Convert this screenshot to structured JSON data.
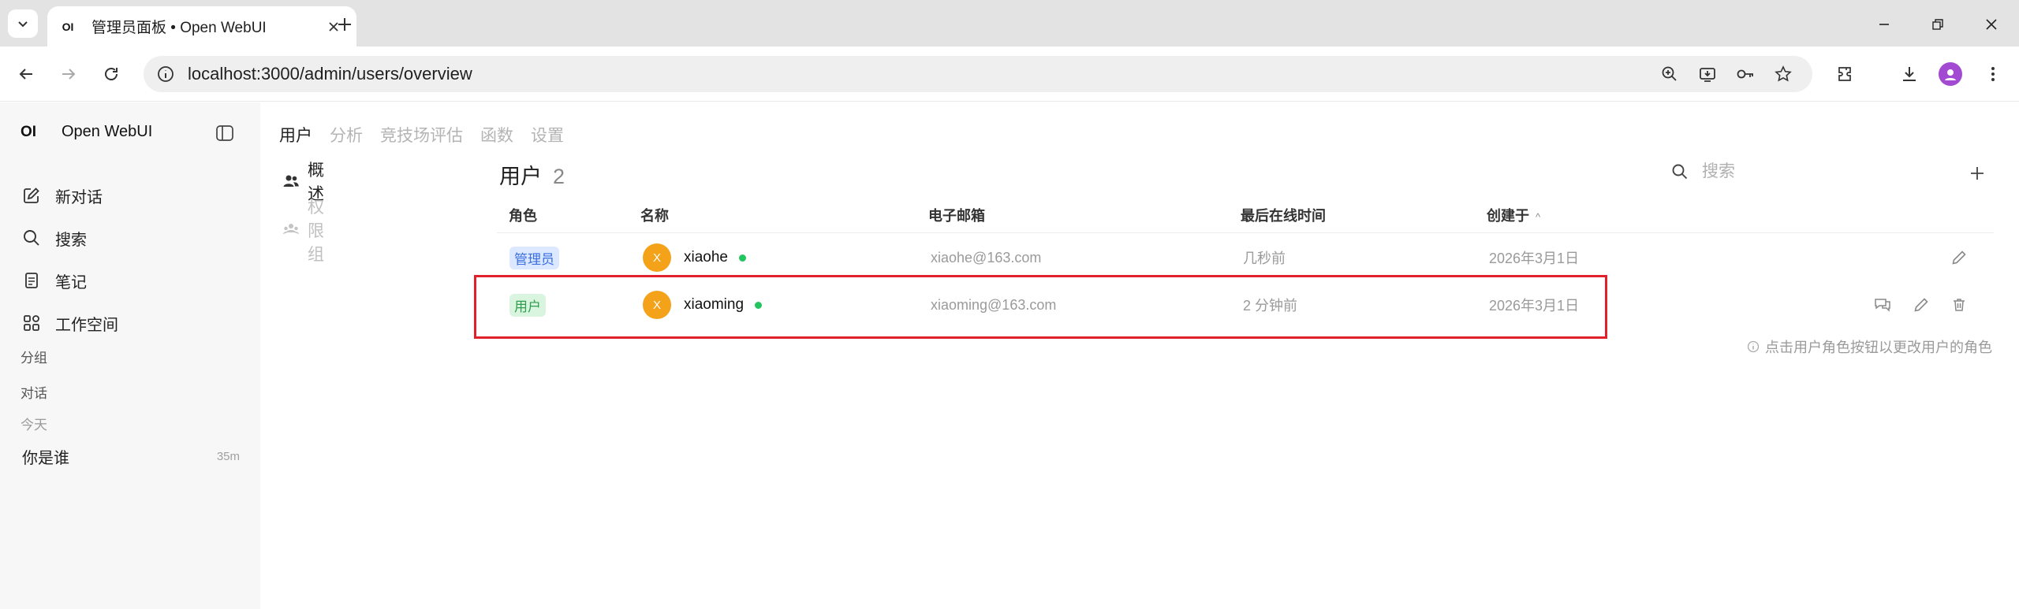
{
  "browser": {
    "tab_title": "管理员面板 • Open WebUI",
    "tab_favicon": "OI",
    "url": "localhost:3000/admin/users/overview"
  },
  "sidebar": {
    "brand_logo": "OI",
    "brand_name": "Open WebUI",
    "items": [
      {
        "label": "新对话",
        "icon": "edit-icon"
      },
      {
        "label": "搜索",
        "icon": "search-icon"
      },
      {
        "label": "笔记",
        "icon": "notes-icon"
      },
      {
        "label": "工作空间",
        "icon": "workspace-icon"
      }
    ],
    "groups_label": "分组",
    "chats_label": "对话",
    "day_label": "今天",
    "chat": {
      "title": "你是谁",
      "time": "35m"
    }
  },
  "admin": {
    "tabs": [
      "用户",
      "分析",
      "竞技场评估",
      "函数",
      "设置"
    ],
    "subnav": [
      {
        "label": "概述",
        "icon": "users-icon"
      },
      {
        "label": "权限组",
        "icon": "group-icon"
      }
    ]
  },
  "users_panel": {
    "title": "用户",
    "count": "2",
    "search_placeholder": "搜索",
    "columns": [
      "角色",
      "名称",
      "电子邮箱",
      "最后在线时间",
      "创建于"
    ],
    "sort_indicator": "^",
    "rows": [
      {
        "role": "管理员",
        "role_type": "admin",
        "avatar": "X",
        "name": "xiaohe",
        "email": "xiaohe@163.com",
        "last_active": "几秒前",
        "created": "2026年3月1日"
      },
      {
        "role": "用户",
        "role_type": "user",
        "avatar": "X",
        "name": "xiaoming",
        "email": "xiaoming@163.com",
        "last_active": "2 分钟前",
        "created": "2026年3月1日"
      }
    ],
    "hint": "点击用户角色按钮以更改用户的角色"
  },
  "colors": {
    "highlight": "#e0202a",
    "online": "#22c55e",
    "avatar": "#f3a21a",
    "admin_badge_bg": "#dbe8ff",
    "user_badge_bg": "#d9f5df"
  }
}
